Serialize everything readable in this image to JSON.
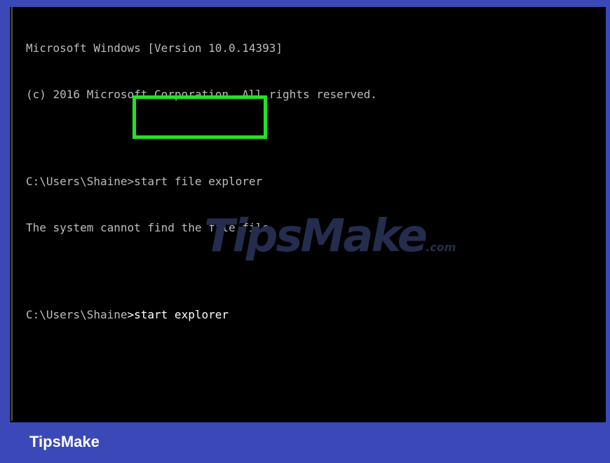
{
  "console": {
    "lines": [
      "Microsoft Windows [Version 10.0.14393]",
      "(c) 2016 Microsoft Corporation. All rights reserved.",
      "C:\\Users\\Shaine>start file explorer",
      "The system cannot find the file file.",
      "C:\\Users\\Shaine"
    ],
    "current_command": ">start explorer"
  },
  "watermark": {
    "text": "TipsMake",
    "suffix": ".com"
  },
  "footer": {
    "brand": "TipsMake"
  },
  "colors": {
    "background": "#3b48b8",
    "console": "#000000",
    "highlight": "#21e421"
  }
}
